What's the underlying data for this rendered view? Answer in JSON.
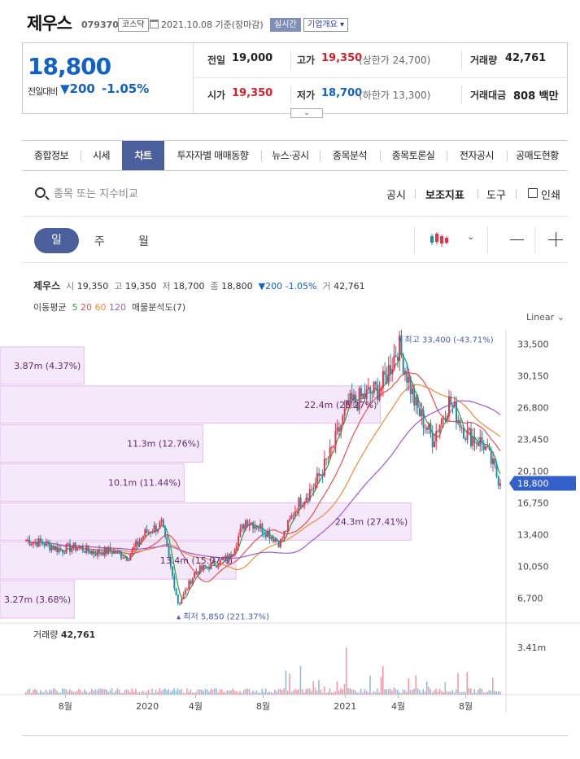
{
  "header": {
    "name": "제우스",
    "code": "079370",
    "market": "코스닥",
    "date": "2021.10.08",
    "basis": "기준(장마감)",
    "live_badge": "실시간",
    "company_badge": "기업개요"
  },
  "price": {
    "current": "18,800",
    "prev_label": "전일대비",
    "change_abs": "200",
    "change_pct": "-1.05%",
    "prev_close_label": "전일",
    "prev_close": "19,000",
    "high_label": "고가",
    "high": "19,350",
    "upper_limit": "(상한가 24,700)",
    "volume_label": "거래량",
    "volume": "42,761",
    "open_label": "시가",
    "open": "19,350",
    "low_label": "저가",
    "low": "18,700",
    "lower_limit": "(하한가 13,300)",
    "amount_label": "거래대금",
    "amount": "808 백만"
  },
  "tabs": [
    "종합정보",
    "시세",
    "차트",
    "투자자별 매매동향",
    "뉴스·공시",
    "종목분석",
    "종목토론실",
    "전자공시",
    "공매도현황"
  ],
  "toolbar": {
    "search_placeholder": "종목 또는 지수비교",
    "disclosure": "공시",
    "indicator": "보조지표",
    "tools": "도구",
    "print": "인쇄"
  },
  "periods": {
    "day": "일",
    "week": "주",
    "month": "월"
  },
  "chart_info": {
    "name": "제우스",
    "open_label": "시",
    "open": "19,350",
    "high_label": "고",
    "high": "19,350",
    "low_label": "저",
    "low": "18,700",
    "close_label": "종",
    "close": "18,800",
    "change": "200",
    "change_pct": "-1.05%",
    "vol_label": "거",
    "vol": "42,761",
    "ma_label": "이동평균",
    "ma_periods": [
      "5",
      "20",
      "60",
      "120"
    ],
    "profile_label": "매물분석도(7)",
    "scale": "Linear"
  },
  "colors": {
    "ma5": "#2e9e3e",
    "ma20": "#e8524f",
    "ma60": "#f08a3e",
    "ma120": "#9b5bd6",
    "up": "#e8324b",
    "down": "#1f8fa0",
    "accent": "#4b5f9c",
    "price_blue": "#1261c4"
  },
  "chart_data": {
    "type": "line",
    "y_ticks": [
      "33,500",
      "30,150",
      "26,800",
      "23,450",
      "20,100",
      "16,750",
      "13,400",
      "10,050",
      "6,700"
    ],
    "y_tick_values": [
      33500,
      30150,
      26800,
      23450,
      20100,
      16750,
      13400,
      10050,
      6700
    ],
    "ylim": [
      4500,
      35000
    ],
    "x_ticks": [
      "8월",
      "2020",
      "4월",
      "8월",
      "2021",
      "4월",
      "8월"
    ],
    "last_price_label": "18,800",
    "last_price": 18800,
    "max_label": "최고 33,400 (-43.71%)",
    "min_label": "최저 5,850 (221.37%)",
    "series_close": [
      {
        "x": "2019-06",
        "y": 12800
      },
      {
        "x": "2019-07",
        "y": 12500
      },
      {
        "x": "2019-08",
        "y": 11800
      },
      {
        "x": "2019-09",
        "y": 12100
      },
      {
        "x": "2019-10",
        "y": 11500
      },
      {
        "x": "2019-11",
        "y": 11700
      },
      {
        "x": "2019-12",
        "y": 11000
      },
      {
        "x": "2020-01",
        "y": 13500
      },
      {
        "x": "2020-02",
        "y": 14500
      },
      {
        "x": "2020-03",
        "y": 6000
      },
      {
        "x": "2020-04",
        "y": 9500
      },
      {
        "x": "2020-05",
        "y": 10200
      },
      {
        "x": "2020-06",
        "y": 11000
      },
      {
        "x": "2020-07",
        "y": 15000
      },
      {
        "x": "2020-08",
        "y": 14000
      },
      {
        "x": "2020-09",
        "y": 12500
      },
      {
        "x": "2020-10",
        "y": 16500
      },
      {
        "x": "2020-11",
        "y": 18500
      },
      {
        "x": "2020-12",
        "y": 22000
      },
      {
        "x": "2021-01",
        "y": 27000
      },
      {
        "x": "2021-02",
        "y": 28000
      },
      {
        "x": "2021-03",
        "y": 29000
      },
      {
        "x": "2021-04",
        "y": 33400
      },
      {
        "x": "2021-05",
        "y": 27000
      },
      {
        "x": "2021-06",
        "y": 23500
      },
      {
        "x": "2021-07",
        "y": 27500
      },
      {
        "x": "2021-08",
        "y": 24000
      },
      {
        "x": "2021-09",
        "y": 23000
      },
      {
        "x": "2021-10",
        "y": 18800
      }
    ],
    "volume_profile": [
      {
        "label": "3.87m (4.37%)",
        "fraction": 0.1287
      },
      {
        "label": "22.4m (25.27%)",
        "fraction": 0.7426
      },
      {
        "label": "11.3m (12.76%)",
        "fraction": 0.375
      },
      {
        "label": "10.1m (11.44%)",
        "fraction": 0.336
      },
      {
        "label": "24.3m (27.41%)",
        "fraction": 0.8063
      },
      {
        "label": "13.4m (15.07%)",
        "fraction": 0.4435
      },
      {
        "label": "3.27m (3.68%)",
        "fraction": 0.1083
      }
    ],
    "volume_title": "거래량",
    "volume_value": "42,761",
    "volume_max_tick": "3.41m"
  }
}
